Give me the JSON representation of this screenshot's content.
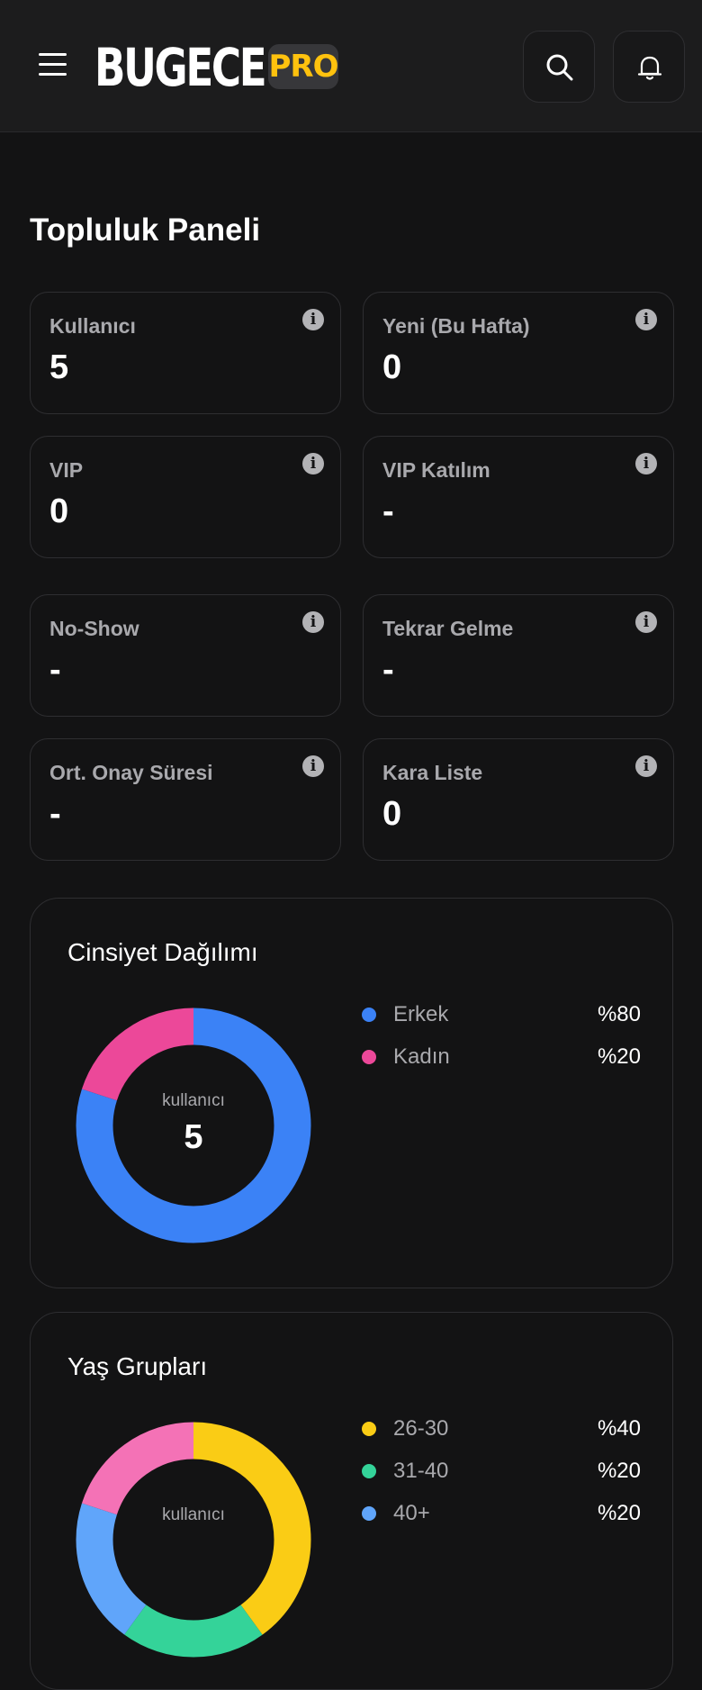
{
  "header": {
    "logo": "BUGECE",
    "badge": "PRO"
  },
  "page": {
    "title": "Topluluk Paneli"
  },
  "stats": [
    {
      "label": "Kullanıcı",
      "value": "5"
    },
    {
      "label": "Yeni (Bu Hafta)",
      "value": "0"
    },
    {
      "label": "VIP",
      "value": "0"
    },
    {
      "label": "VIP Katılım",
      "value": "-"
    },
    {
      "label": "No-Show",
      "value": "-"
    },
    {
      "label": "Tekrar Gelme",
      "value": "-"
    },
    {
      "label": "Ort. Onay Süresi",
      "value": "-"
    },
    {
      "label": "Kara Liste",
      "value": "0"
    }
  ],
  "gender": {
    "title": "Cinsiyet Dağılımı",
    "center_label": "kullanıcı",
    "center_value": "5",
    "items": [
      {
        "name": "Erkek",
        "pct_label": "%80",
        "pct": 80,
        "color": "#3b82f6"
      },
      {
        "name": "Kadın",
        "pct_label": "%20",
        "pct": 20,
        "color": "#ec4899"
      }
    ]
  },
  "age": {
    "title": "Yaş Grupları",
    "center_label": "kullanıcı",
    "items": [
      {
        "name": "26-30",
        "pct_label": "%40",
        "pct": 40,
        "color": "#facc15"
      },
      {
        "name": "31-40",
        "pct_label": "%20",
        "pct": 20,
        "color": "#34d399"
      },
      {
        "name": "40+",
        "pct_label": "%20",
        "pct": 20,
        "color": "#60a5fa"
      }
    ],
    "extra_segment_color": "#f472b6"
  },
  "colors": {
    "accent": "#ffc20e",
    "background": "#131314"
  }
}
